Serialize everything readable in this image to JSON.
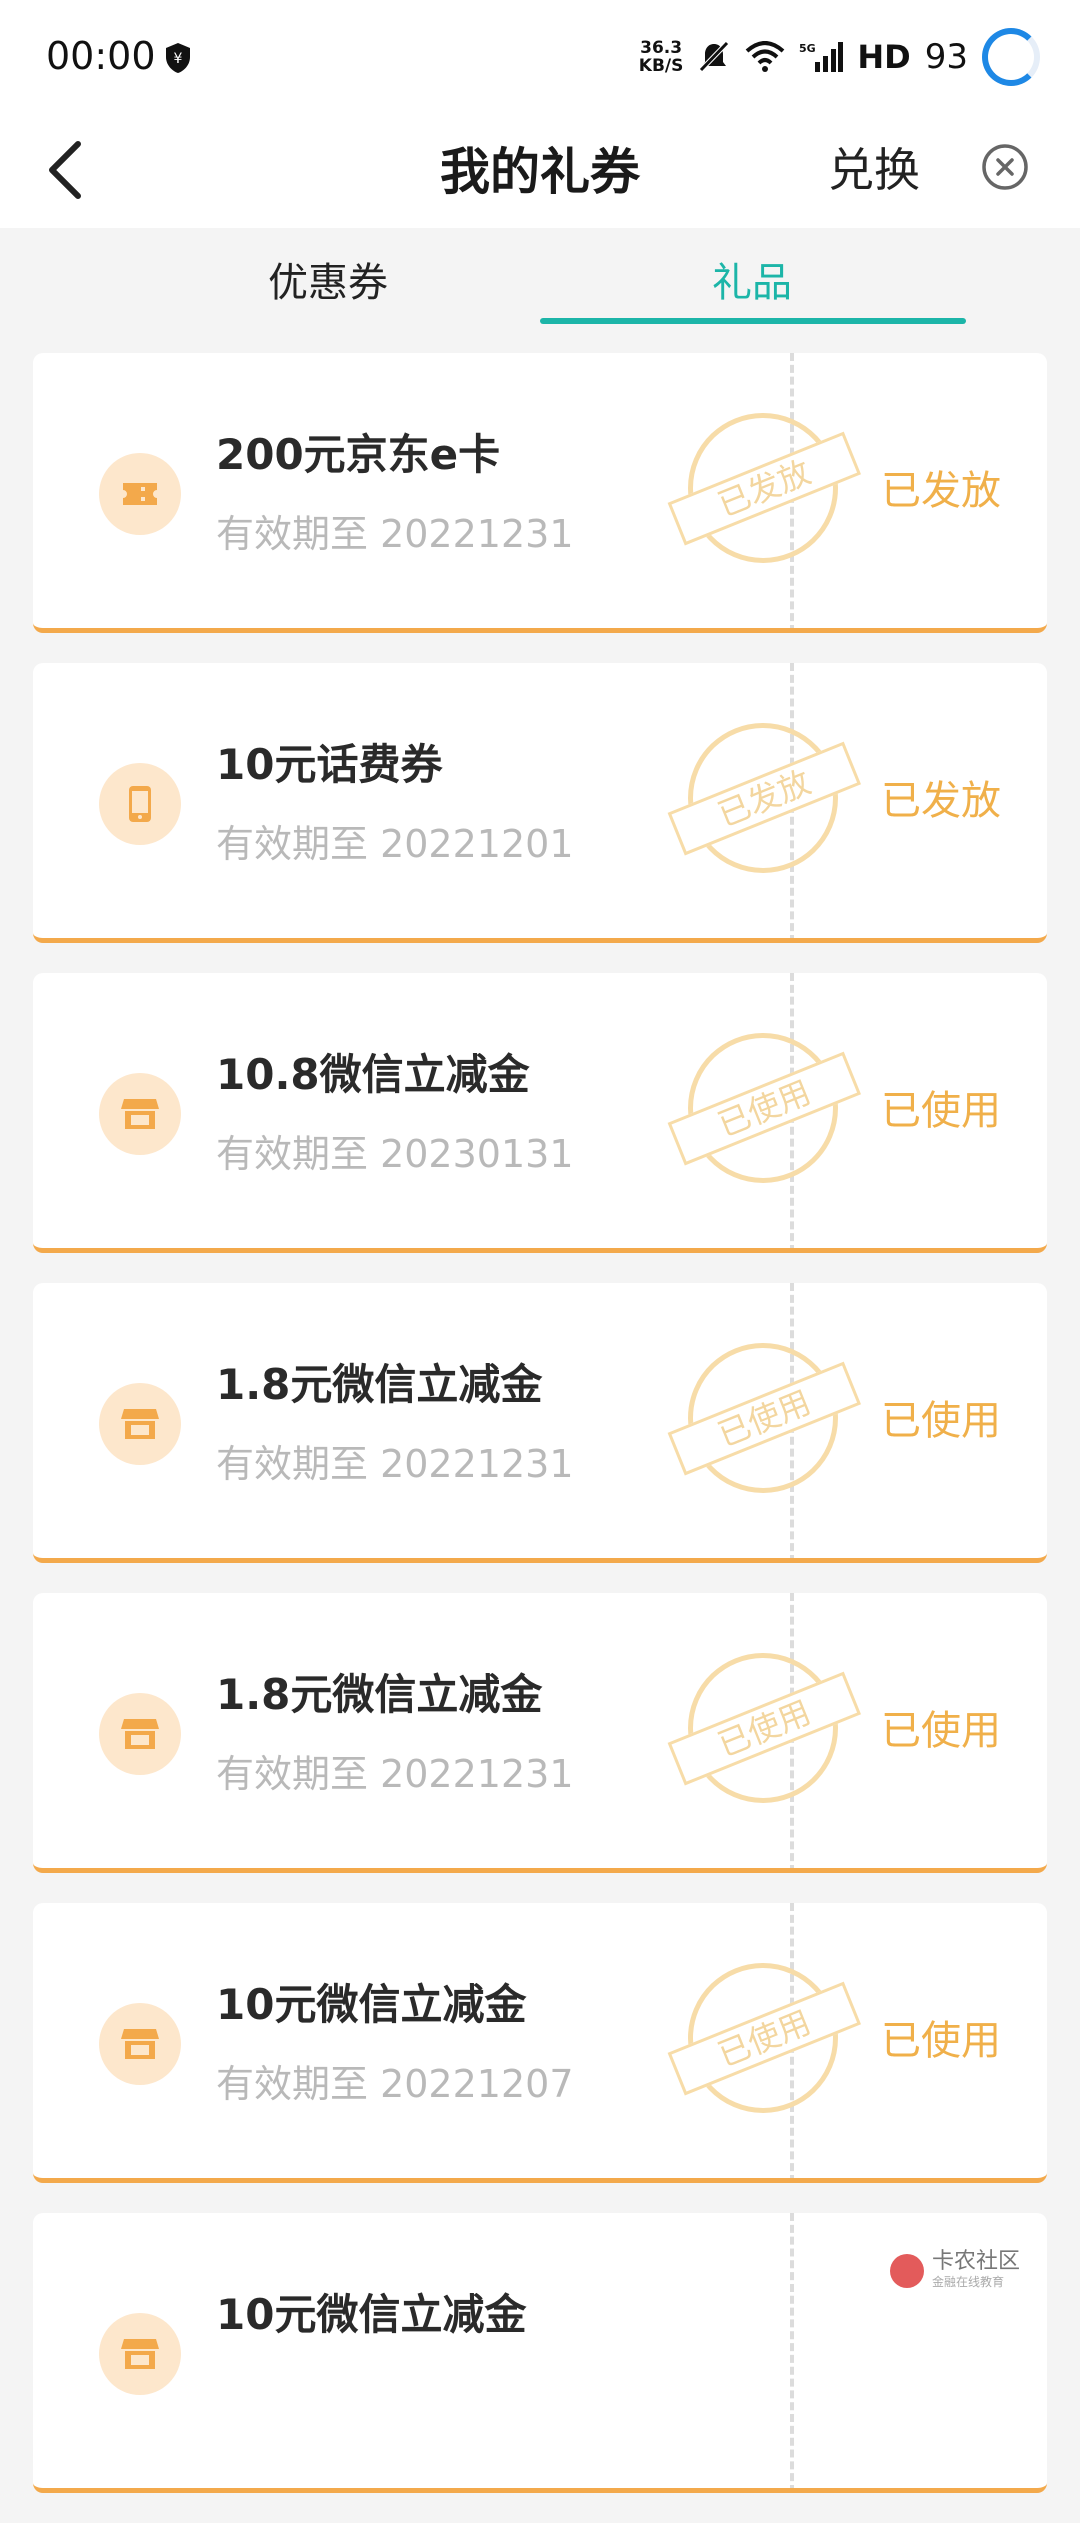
{
  "status_bar": {
    "time": "00:00",
    "speed_top": "36.3",
    "speed_bottom": "KB/S",
    "network": "5G",
    "hd": "HD",
    "battery": "93",
    "icons": [
      "shield-yen-icon",
      "mute-icon",
      "wifi-icon",
      "signal-icon"
    ]
  },
  "nav": {
    "title": "我的礼券",
    "exchange": "兑换",
    "back_icon": "chevron-left-icon",
    "close_icon": "close-circle-icon"
  },
  "tabs": {
    "coupons": "优惠券",
    "gifts": "礼品",
    "active": "gifts"
  },
  "gifts": [
    {
      "title": "200元京东e卡",
      "expiry": "有效期至 20221231",
      "stamp": "已发放",
      "status": "已发放",
      "icon": "ticket-icon"
    },
    {
      "title": "10元话费券",
      "expiry": "有效期至 20221201",
      "stamp": "已发放",
      "status": "已发放",
      "icon": "phone-icon"
    },
    {
      "title": "10.8微信立减金",
      "expiry": "有效期至 20230131",
      "stamp": "已使用",
      "status": "已使用",
      "icon": "store-icon"
    },
    {
      "title": "1.8元微信立减金",
      "expiry": "有效期至 20221231",
      "stamp": "已使用",
      "status": "已使用",
      "icon": "store-icon"
    },
    {
      "title": "1.8元微信立减金",
      "expiry": "有效期至 20221231",
      "stamp": "已使用",
      "status": "已使用",
      "icon": "store-icon"
    },
    {
      "title": "10元微信立减金",
      "expiry": "有效期至 20221207",
      "stamp": "已使用",
      "status": "已使用",
      "icon": "store-icon"
    },
    {
      "title": "10元微信立减金",
      "expiry": "",
      "stamp": "",
      "status": "",
      "icon": "store-icon"
    }
  ],
  "watermark": {
    "text": "卡农社区",
    "sub": "金融在线教育"
  },
  "colors": {
    "accent": "#1cb5a8",
    "orange": "#f3a94b",
    "stamp": "#f7dca8"
  }
}
